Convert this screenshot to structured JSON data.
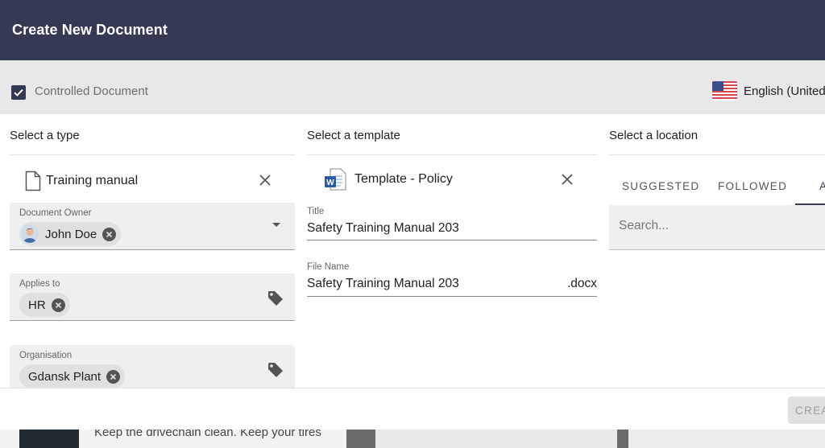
{
  "dialog": {
    "title": "Create New Document",
    "controlled_label": "Controlled Document",
    "controlled_checked": true,
    "language": "English (United",
    "create_label": "CREA"
  },
  "type_column": {
    "heading": "Select a type",
    "selected_type": "Training manual",
    "owner_label": "Document Owner",
    "owner_value": "John Doe",
    "applies_label": "Applies to",
    "applies_value": "HR",
    "org_label": "Organisation",
    "org_value": "Gdansk Plant"
  },
  "template_column": {
    "heading": "Select a template",
    "selected_template": "Template - Policy",
    "title_label": "Title",
    "title_value": "Safety Training Manual 203",
    "filename_label": "File Name",
    "filename_value": "Safety Training Manual 203",
    "filename_ext": ".docx"
  },
  "location_column": {
    "heading": "Select a location",
    "tabs": [
      "SUGGESTED",
      "FOLLOWED",
      "A"
    ],
    "active_tab": 2,
    "search_placeholder": "Search..."
  },
  "background": {
    "snippet_text": "Keep the drivechain clean. Keep your tires"
  },
  "colors": {
    "header": "#343a54",
    "option_bar": "#e8e8e8",
    "field_fill": "#efefef"
  }
}
